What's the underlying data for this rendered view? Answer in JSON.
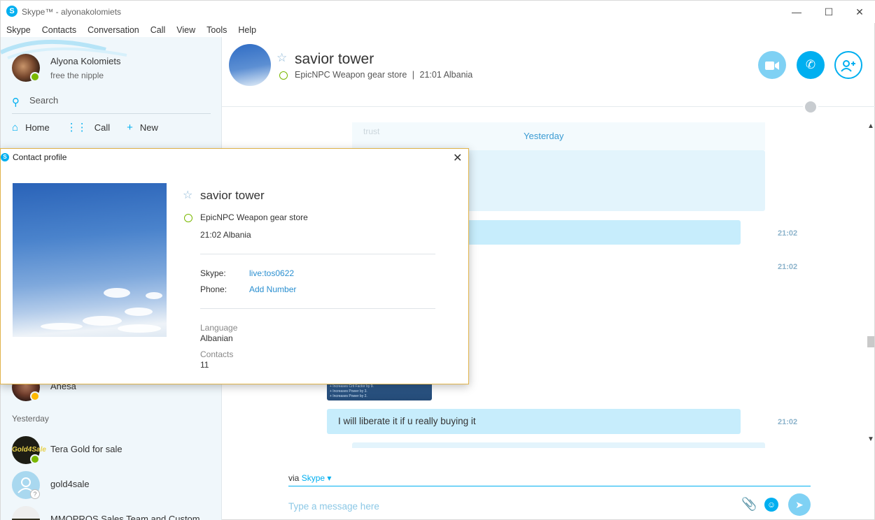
{
  "window": {
    "title": "Skype™ - alyonakolomiets",
    "controls": {
      "minimize": "—",
      "maximize": "☐",
      "close": "✕"
    }
  },
  "menu": [
    "Skype",
    "Contacts",
    "Conversation",
    "Call",
    "View",
    "Tools",
    "Help"
  ],
  "sidebar": {
    "me": {
      "name": "Alyona Kolomiets",
      "mood": "free the nipple",
      "status": "online"
    },
    "search_label": "Search",
    "nav": [
      {
        "label": "Home",
        "icon": "home-icon"
      },
      {
        "label": "Call",
        "icon": "dialpad-icon"
      },
      {
        "label": "New",
        "icon": "plus-icon"
      }
    ],
    "recent": [
      {
        "name": "Anesa",
        "status": "away"
      },
      {
        "name": "Tera Gold for sale",
        "status": "online"
      },
      {
        "name": "gold4sale",
        "status": "unknown"
      },
      {
        "name": "MMOPROS Sales Team and Custom"
      }
    ],
    "day_label": "Yesterday"
  },
  "conversation": {
    "name": "savior tower",
    "mood": "EpicNPC Weapon gear store",
    "separator": "|",
    "local_time": "21:01 Albania",
    "day_separator": "Yesterday",
    "faint_text": "trust",
    "messages": [
      {
        "text": "",
        "time": "21:02"
      },
      {
        "text": "",
        "time": "21:02"
      },
      {
        "text": "I will liberate it if u really buying it",
        "time": "21:02"
      }
    ],
    "image_caption": [
      "+ Increases Crit Factor by 9.",
      "+ Increases Power by 3.",
      "+ Increases Power by 2."
    ]
  },
  "compose": {
    "via_label": "via",
    "via_service": "Skype",
    "placeholder": "Type a message here"
  },
  "dialog": {
    "title": "Contact profile",
    "name": "savior tower",
    "mood": "EpicNPC Weapon gear store",
    "local_time": "21:02 Albania",
    "skype_label": "Skype:",
    "skype_value": "live:tos0622",
    "phone_label": "Phone:",
    "phone_value": "Add Number",
    "language_label": "Language",
    "language_value": "Albanian",
    "contacts_label": "Contacts",
    "contacts_value": "11"
  },
  "colors": {
    "accent": "#00aff0",
    "online": "#7ab800",
    "away": "#ffb900",
    "bubble": "#c7edfc",
    "dialog_border": "#e0b34a"
  }
}
